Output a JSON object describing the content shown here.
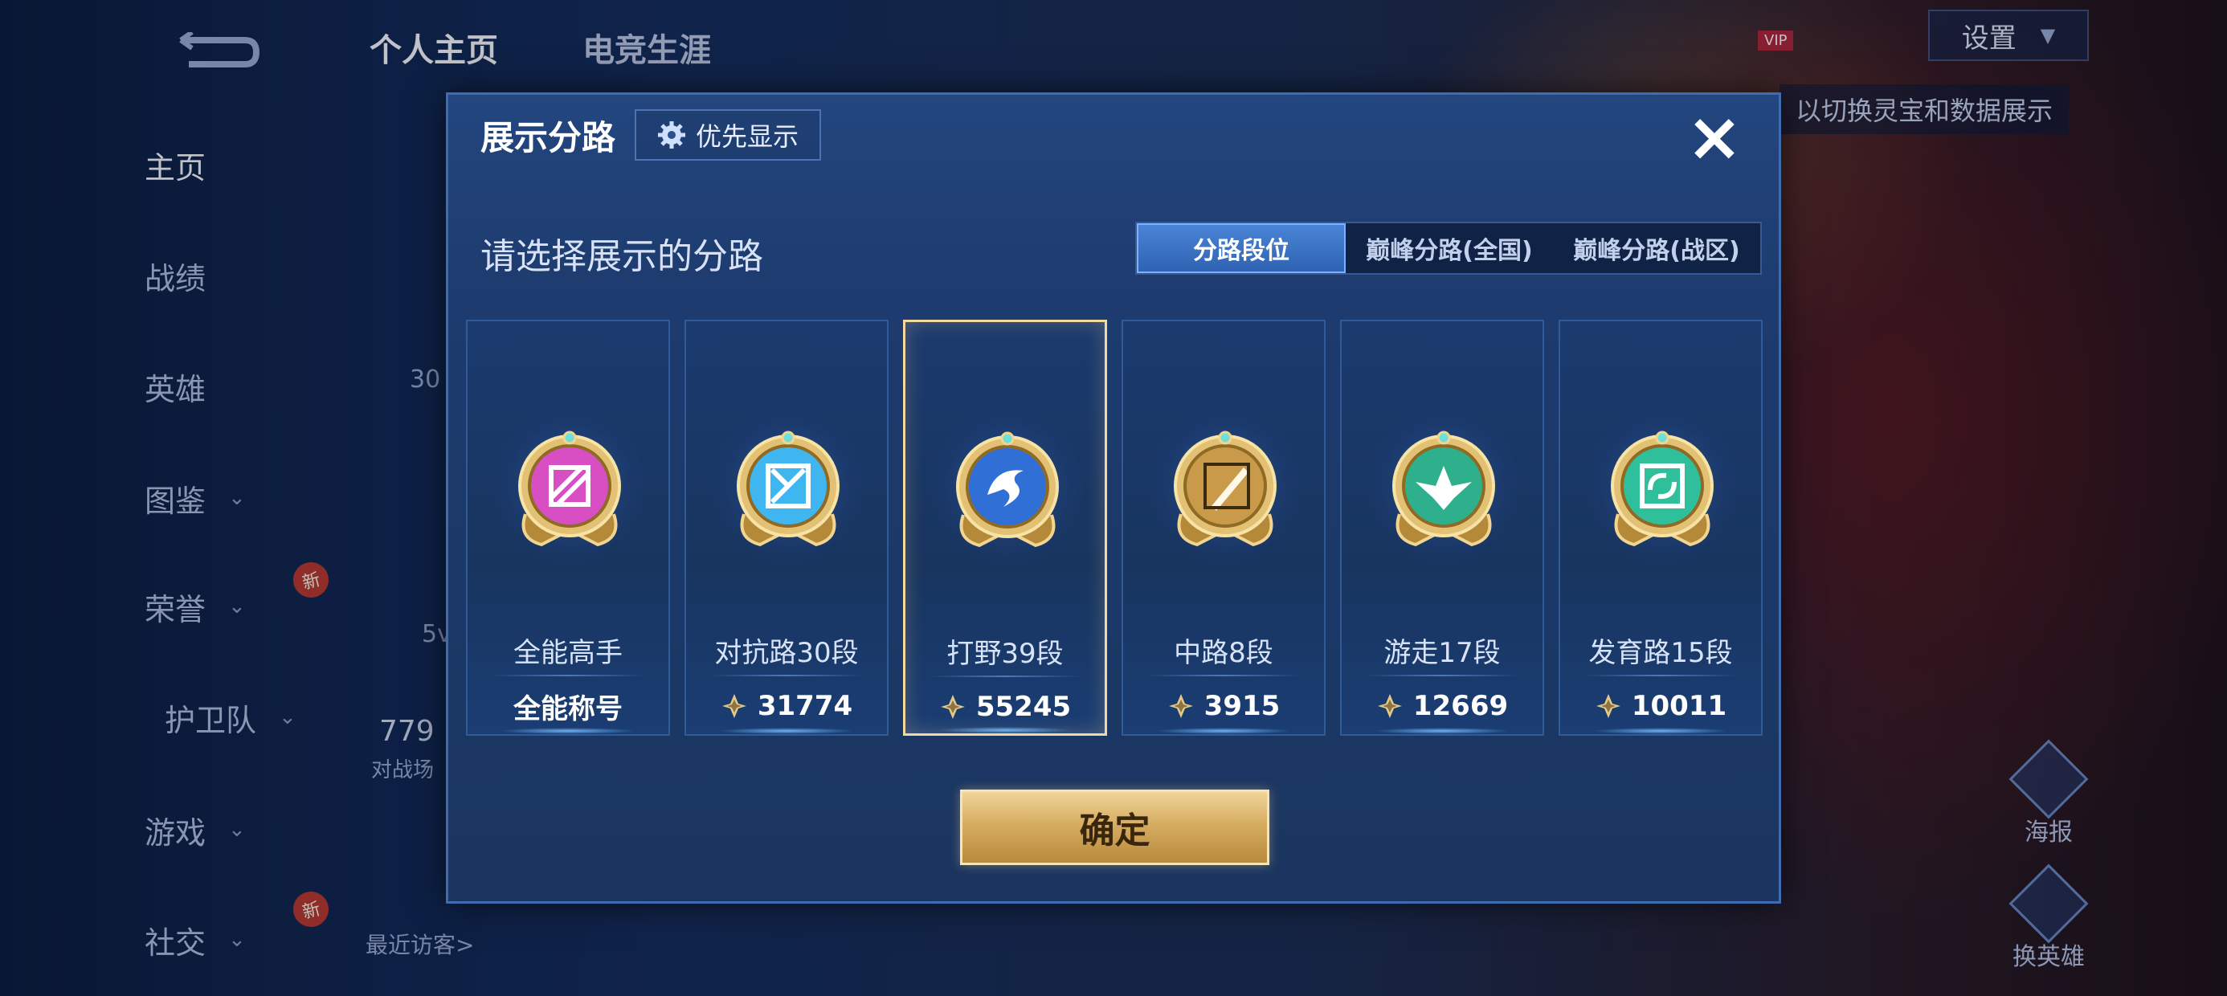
{
  "background": {
    "top_tabs": [
      "个人主页",
      "电竞生涯"
    ],
    "nav": [
      {
        "label": "主页",
        "active": true,
        "chevron": false,
        "new": false
      },
      {
        "label": "战绩",
        "active": false,
        "chevron": false,
        "new": false
      },
      {
        "label": "英雄",
        "active": false,
        "chevron": false,
        "new": false
      },
      {
        "label": "图鉴",
        "active": false,
        "chevron": true,
        "new": false
      },
      {
        "label": "荣誉",
        "active": false,
        "chevron": true,
        "new": true
      },
      {
        "label": "护卫队",
        "active": false,
        "chevron": true,
        "new": false
      },
      {
        "label": "游戏",
        "active": false,
        "chevron": true,
        "new": false
      },
      {
        "label": "社交",
        "active": false,
        "chevron": true,
        "new": true
      }
    ],
    "new_badge_text": "新",
    "settings_label": "设置",
    "switch_hint": "以切换灵宝和数据展示",
    "vip_label": "VIP",
    "recent_visitors": "最近访客>",
    "right_buttons": [
      "海报",
      "换英雄"
    ],
    "partial_texts": [
      "30",
      "5v",
      "779",
      "对战场"
    ]
  },
  "modal": {
    "title": "展示分路",
    "priority_button": "优先显示",
    "close_icon": "×",
    "subtitle": "请选择展示的分路",
    "segments": [
      {
        "label": "分路段位",
        "active": true
      },
      {
        "label": "巅峰分路(全国)",
        "active": false
      },
      {
        "label": "巅峰分路(战区)",
        "active": false
      }
    ],
    "cards": [
      {
        "name": "全能高手",
        "value": "全能称号",
        "show_icon": false,
        "badge": "all-rounder-badge-icon",
        "color": "#d84fc4",
        "selected": false
      },
      {
        "name": "对抗路30段",
        "value": "31774",
        "show_icon": true,
        "badge": "clash-lane-badge-icon",
        "color": "#3fb6f0",
        "selected": false
      },
      {
        "name": "打野39段",
        "value": "55245",
        "show_icon": true,
        "badge": "jungle-badge-icon",
        "color": "#2f6fd6",
        "selected": true
      },
      {
        "name": "中路8段",
        "value": "3915",
        "show_icon": true,
        "badge": "mid-lane-badge-icon",
        "color": "#c89a4a",
        "selected": false
      },
      {
        "name": "游走17段",
        "value": "12669",
        "show_icon": true,
        "badge": "roam-badge-icon",
        "color": "#2fb08c",
        "selected": false
      },
      {
        "name": "发育路15段",
        "value": "10011",
        "show_icon": true,
        "badge": "farm-lane-badge-icon",
        "color": "#2fbf9a",
        "selected": false
      }
    ],
    "confirm_button": "确定"
  }
}
